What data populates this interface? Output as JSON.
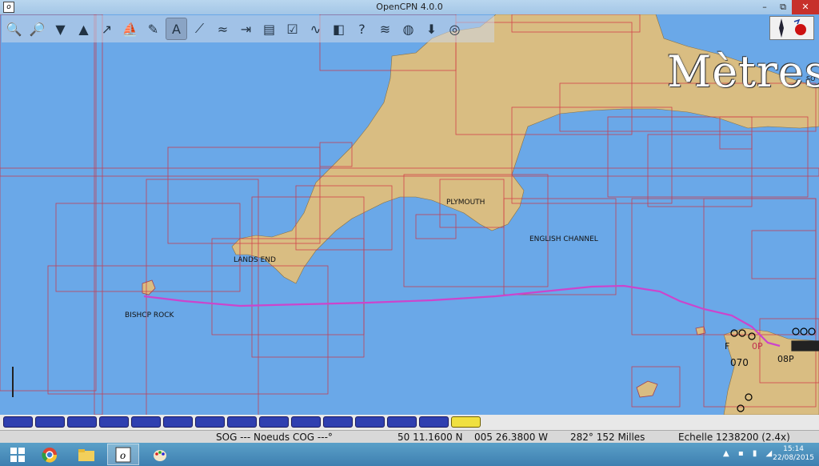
{
  "window": {
    "title": "OpenCPN 4.0.0",
    "min": "–",
    "max": "⧉",
    "close": "✕"
  },
  "toolbar": [
    "zoom-in-icon",
    "zoom-out-icon",
    "scale-down-icon",
    "scale-up-icon",
    "route-icon",
    "ship-icon",
    "settings-icon",
    "text-icon",
    "measure-icon",
    "tides-icon",
    "currents-icon",
    "print-icon",
    "route-manager-icon",
    "track-icon",
    "color-scheme-icon",
    "help-icon",
    "grib-icon",
    "globe-icon",
    "chart-downloader-icon",
    "life-ring-icon"
  ],
  "map": {
    "depth_unit": "Mètres",
    "labels": {
      "plymouth": "PLYMOUTH",
      "english_channel": "ENGLISH CHANNEL",
      "lands_end": "LANDS END",
      "bishop_rock": "BISHCP ROCK",
      "sounding_1": "070",
      "sounding_2": "08P",
      "sounding_3": "0P",
      "sounding_4": "F",
      "sounding_5": "SO"
    },
    "colors": {
      "sea": "#6aa8e8",
      "land": "#d9bd82",
      "track": "#cc44cc",
      "chart_outline": "#d03040"
    }
  },
  "quilt": {
    "pieces": 15,
    "current_index": 14
  },
  "status": {
    "sog_cog": "SOG --- Noeuds COG ---°",
    "lat": "50 11.1600 N",
    "lon": "005 26.3800 W",
    "bearing_distance": "282°  152 Milles",
    "scale": "Echelle 1238200 (2.4x)"
  },
  "taskbar": {
    "time": "15:14",
    "date": "22/08/2015"
  }
}
